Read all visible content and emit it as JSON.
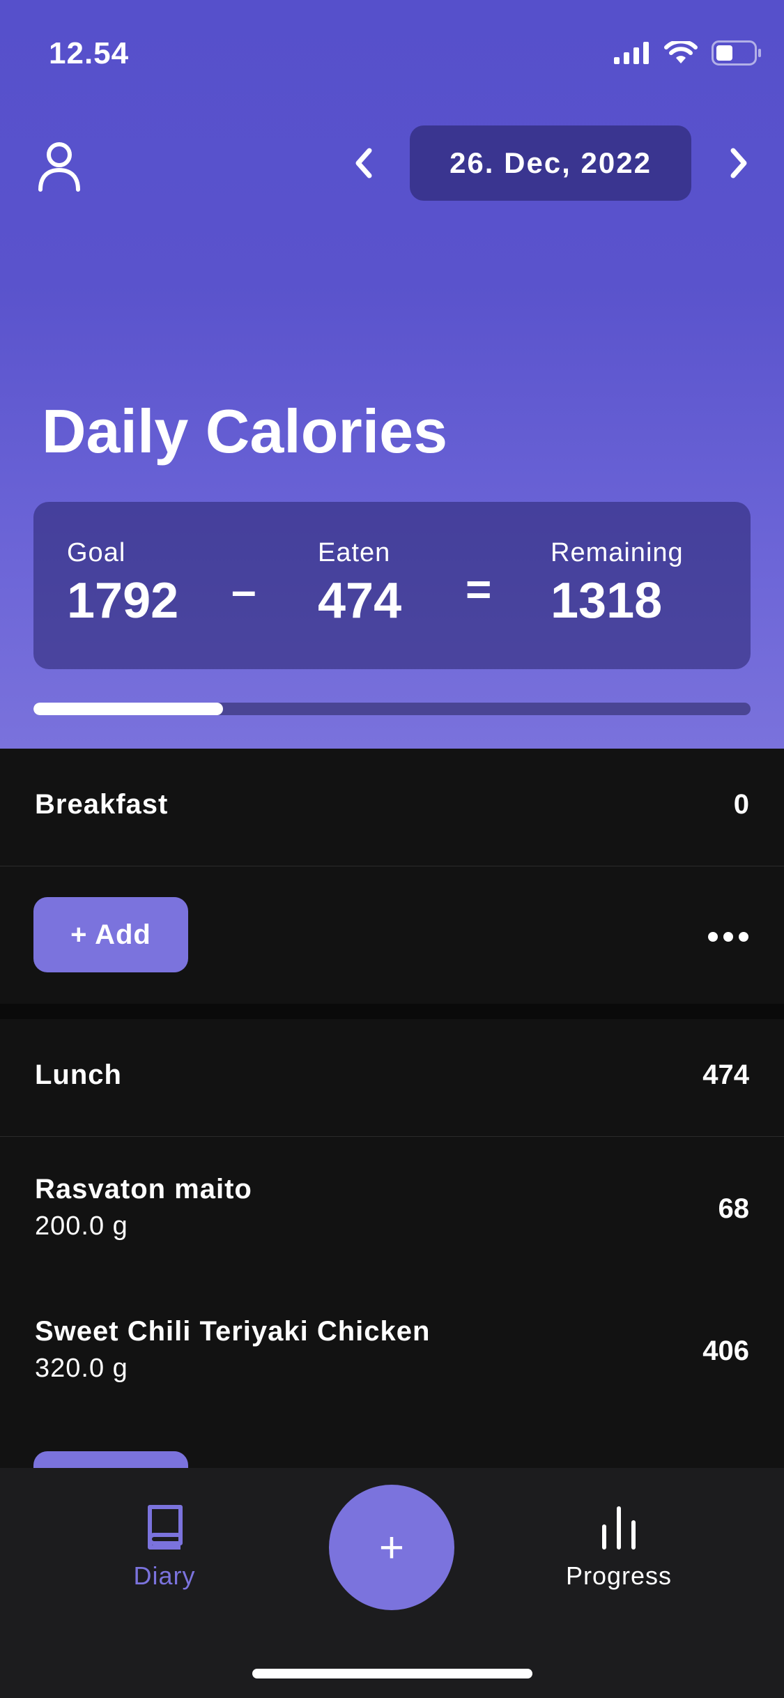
{
  "status_bar": {
    "time": "12.54",
    "signal_icon": "cellular-signal-icon",
    "wifi_icon": "wifi-icon",
    "battery_icon": "battery-icon",
    "battery_level": 0.45
  },
  "header": {
    "profile_icon": "person-icon",
    "prev_icon": "chevron-left-icon",
    "next_icon": "chevron-right-icon",
    "date": "26. Dec, 2022"
  },
  "title": "Daily Calories",
  "summary": {
    "goal_label": "Goal",
    "goal_value": "1792",
    "minus": "–",
    "eaten_label": "Eaten",
    "eaten_value": "474",
    "equals": "=",
    "remaining_label": "Remaining",
    "remaining_value": "1318",
    "progress_fraction": 0.264
  },
  "meals": {
    "breakfast": {
      "name": "Breakfast",
      "total": "0",
      "add_label": "+ Add",
      "more_icon": "more-horizontal-icon"
    },
    "lunch": {
      "name": "Lunch",
      "total": "474",
      "items": [
        {
          "name": "Rasvaton maito",
          "amount": "200.0 g",
          "calories": "68"
        },
        {
          "name": "Sweet Chili Teriyaki Chicken",
          "amount": "320.0 g",
          "calories": "406"
        }
      ]
    }
  },
  "tab_bar": {
    "diary_label": "Diary",
    "diary_icon": "book-icon",
    "add_symbol": "+",
    "progress_label": "Progress",
    "progress_icon": "bar-chart-icon"
  },
  "colors": {
    "accent": "#7b73dd",
    "hero_top": "#5650cb",
    "date_pill": "#3a3590",
    "background": "#121212",
    "tab_bar": "#1c1c1e"
  }
}
